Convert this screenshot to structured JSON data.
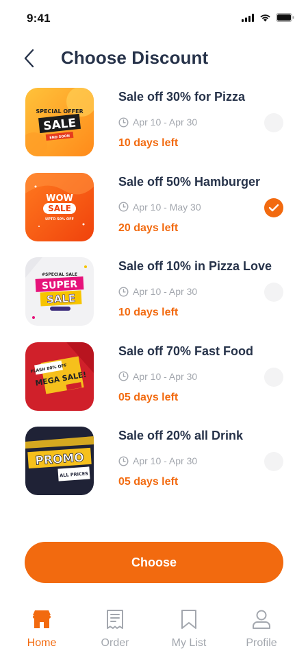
{
  "status_bar": {
    "time": "9:41"
  },
  "header": {
    "title": "Choose Discount"
  },
  "discounts": [
    {
      "title": "Sale off 30% for Pizza",
      "date": "Apr 10 - Apr 30",
      "days_left": "10 days left",
      "selected": false,
      "banner": {
        "line1": "SPECIAL OFFER",
        "line2": "SALE",
        "line3": "END SOON"
      }
    },
    {
      "title": "Sale off 50% Hamburger",
      "date": "Apr 10 - May 30",
      "days_left": "20 days left",
      "selected": true,
      "banner": {
        "line1": "WOW",
        "line2": "SALE",
        "line3": "UPTO 50% OFF"
      }
    },
    {
      "title": "Sale off 10% in Pizza Love",
      "date": "Apr 10 - Apr 30",
      "days_left": "10 days left",
      "selected": false,
      "banner": {
        "line1": "#SPECIAL SALE",
        "line2": "SUPER",
        "line3": "SALE"
      }
    },
    {
      "title": "Sale off 70% Fast Food",
      "date": "Apr 10 - Apr 30",
      "days_left": "05 days left",
      "selected": false,
      "banner": {
        "line1": "FLASH 80% OFF",
        "line2": "MEGA SALE!",
        "line3": ""
      }
    },
    {
      "title": "Sale off 20% all Drink",
      "date": "Apr 10 - Apr 30",
      "days_left": "05 days left",
      "selected": false,
      "banner": {
        "line1": "PROMO",
        "line2": "ALL PRICES",
        "line3": ""
      }
    }
  ],
  "actions": {
    "choose_label": "Choose"
  },
  "bottom_nav": [
    {
      "label": "Home",
      "icon": "store-icon",
      "active": true
    },
    {
      "label": "Order",
      "icon": "receipt-icon",
      "active": false
    },
    {
      "label": "My List",
      "icon": "bookmark-icon",
      "active": false
    },
    {
      "label": "Profile",
      "icon": "user-icon",
      "active": false
    }
  ],
  "colors": {
    "accent": "#f26a0f",
    "title": "#27334a",
    "muted": "#a3a7ae"
  }
}
